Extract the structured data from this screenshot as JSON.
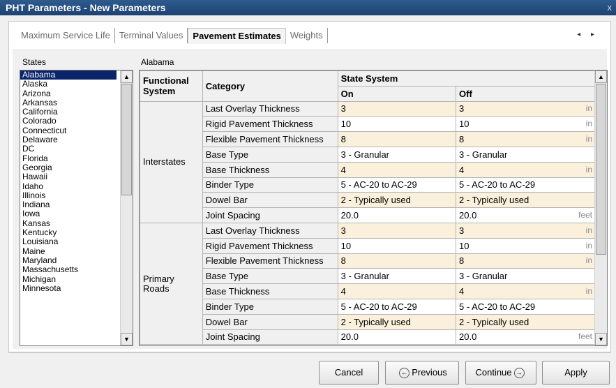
{
  "window": {
    "title": "PHT Parameters - New Parameters",
    "close_glyph": "x"
  },
  "tabs": [
    {
      "label": "Maximum Service Life",
      "active": false
    },
    {
      "label": "Terminal Values",
      "active": false
    },
    {
      "label": "Pavement Estimates",
      "active": true
    },
    {
      "label": "Weights",
      "active": false
    }
  ],
  "tab_scroll_arrows": "◂ ▸",
  "states": {
    "label": "States",
    "selected": "Alabama",
    "items": [
      "Alabama",
      "Alaska",
      "Arizona",
      "Arkansas",
      "California",
      "Colorado",
      "Connecticut",
      "Delaware",
      "DC",
      "Florida",
      "Georgia",
      "Hawaii",
      "Idaho",
      "Illinois",
      "Indiana",
      "Iowa",
      "Kansas",
      "Kentucky",
      "Louisiana",
      "Maine",
      "Maryland",
      "Massachusetts",
      "Michigan",
      "Minnesota"
    ]
  },
  "grid": {
    "state_title": "Alabama",
    "headers": {
      "functional_system": "Functional System",
      "category": "Category",
      "state_system": "State System",
      "on": "On",
      "off": "Off"
    },
    "groups": [
      {
        "name": "Interstates",
        "rows": [
          {
            "category": "Last Overlay Thickness",
            "on": "3",
            "off": "3",
            "unit": "in"
          },
          {
            "category": "Rigid Pavement Thickness",
            "on": "10",
            "off": "10",
            "unit": "in"
          },
          {
            "category": "Flexible Pavement Thickness",
            "on": "8",
            "off": "8",
            "unit": "in"
          },
          {
            "category": "Base Type",
            "on": "3 - Granular",
            "off": "3 - Granular",
            "unit": ""
          },
          {
            "category": "Base Thickness",
            "on": "4",
            "off": "4",
            "unit": "in"
          },
          {
            "category": "Binder Type",
            "on": "5 - AC-20 to AC-29",
            "off": "5 - AC-20 to AC-29",
            "unit": ""
          },
          {
            "category": "Dowel Bar",
            "on": "2 - Typically used",
            "off": "2 - Typically used",
            "unit": ""
          },
          {
            "category": "Joint Spacing",
            "on": "20.0",
            "off": "20.0",
            "unit": "feet"
          }
        ]
      },
      {
        "name": "Primary Roads",
        "rows": [
          {
            "category": "Last Overlay Thickness",
            "on": "3",
            "off": "3",
            "unit": "in"
          },
          {
            "category": "Rigid Pavement Thickness",
            "on": "10",
            "off": "10",
            "unit": "in"
          },
          {
            "category": "Flexible Pavement Thickness",
            "on": "8",
            "off": "8",
            "unit": "in"
          },
          {
            "category": "Base Type",
            "on": "3 - Granular",
            "off": "3 - Granular",
            "unit": ""
          },
          {
            "category": "Base Thickness",
            "on": "4",
            "off": "4",
            "unit": "in"
          },
          {
            "category": "Binder Type",
            "on": "5 - AC-20 to AC-29",
            "off": "5 - AC-20 to AC-29",
            "unit": ""
          },
          {
            "category": "Dowel Bar",
            "on": "2 - Typically used",
            "off": "2 - Typically used",
            "unit": ""
          },
          {
            "category": "Joint Spacing",
            "on": "20.0",
            "off": "20.0",
            "unit": "feet"
          }
        ]
      }
    ]
  },
  "buttons": {
    "cancel": "Cancel",
    "previous": "Previous",
    "continue": "Continue",
    "apply": "Apply"
  },
  "icons": {
    "previous": "arrow-left-circle-icon",
    "continue": "arrow-right-circle-icon",
    "scroll_up": "scroll-up-arrow-icon",
    "scroll_down": "scroll-down-arrow-icon"
  }
}
